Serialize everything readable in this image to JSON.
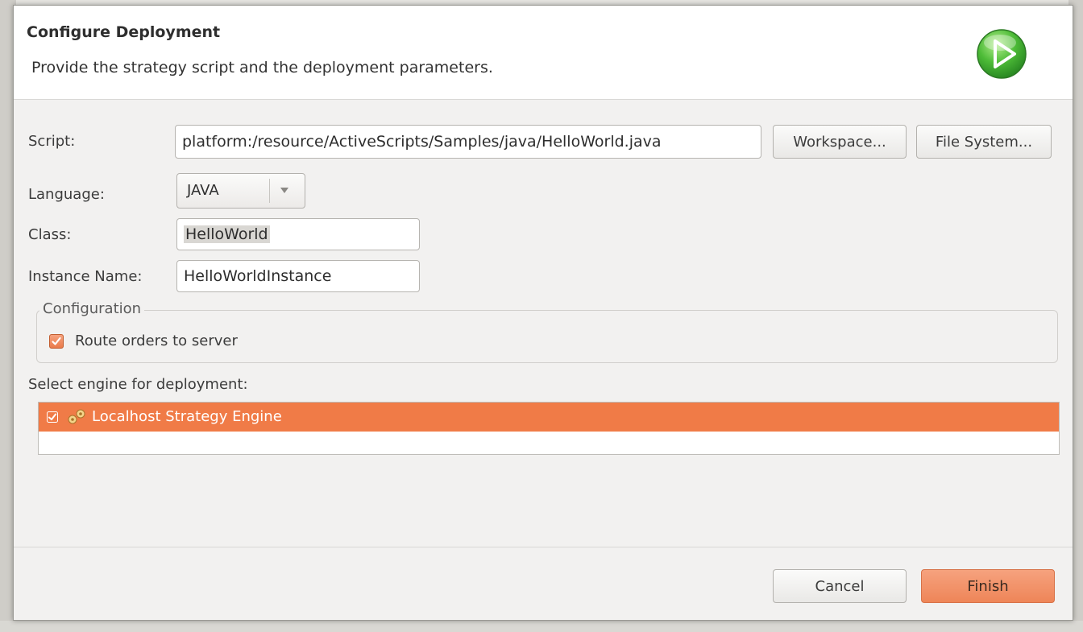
{
  "dialog": {
    "title": "Configure Deployment",
    "description": "Provide the strategy script and the deployment parameters."
  },
  "form": {
    "script_label": "Script:",
    "script_value": "platform:/resource/ActiveScripts/Samples/java/HelloWorld.java",
    "workspace_button": "Workspace...",
    "filesystem_button": "File System...",
    "language_label": "Language:",
    "language_value": "JAVA",
    "class_label": "Class:",
    "class_value": "HelloWorld",
    "instance_label": "Instance Name:",
    "instance_value": "HelloWorldInstance"
  },
  "configuration": {
    "group_title": "Configuration",
    "route_orders_label": "Route orders to server",
    "route_orders_checked": true
  },
  "engines": {
    "label": "Select engine for deployment:",
    "items": [
      {
        "label": "Localhost Strategy Engine",
        "checked": true,
        "selected": true
      }
    ]
  },
  "footer": {
    "cancel_label": "Cancel",
    "finish_label": "Finish"
  },
  "colors": {
    "accent": "#f07b47",
    "play_icon": "#3fae3a"
  },
  "icons": {
    "header": "play-icon",
    "engine": "gears-icon",
    "check": "check-icon"
  }
}
